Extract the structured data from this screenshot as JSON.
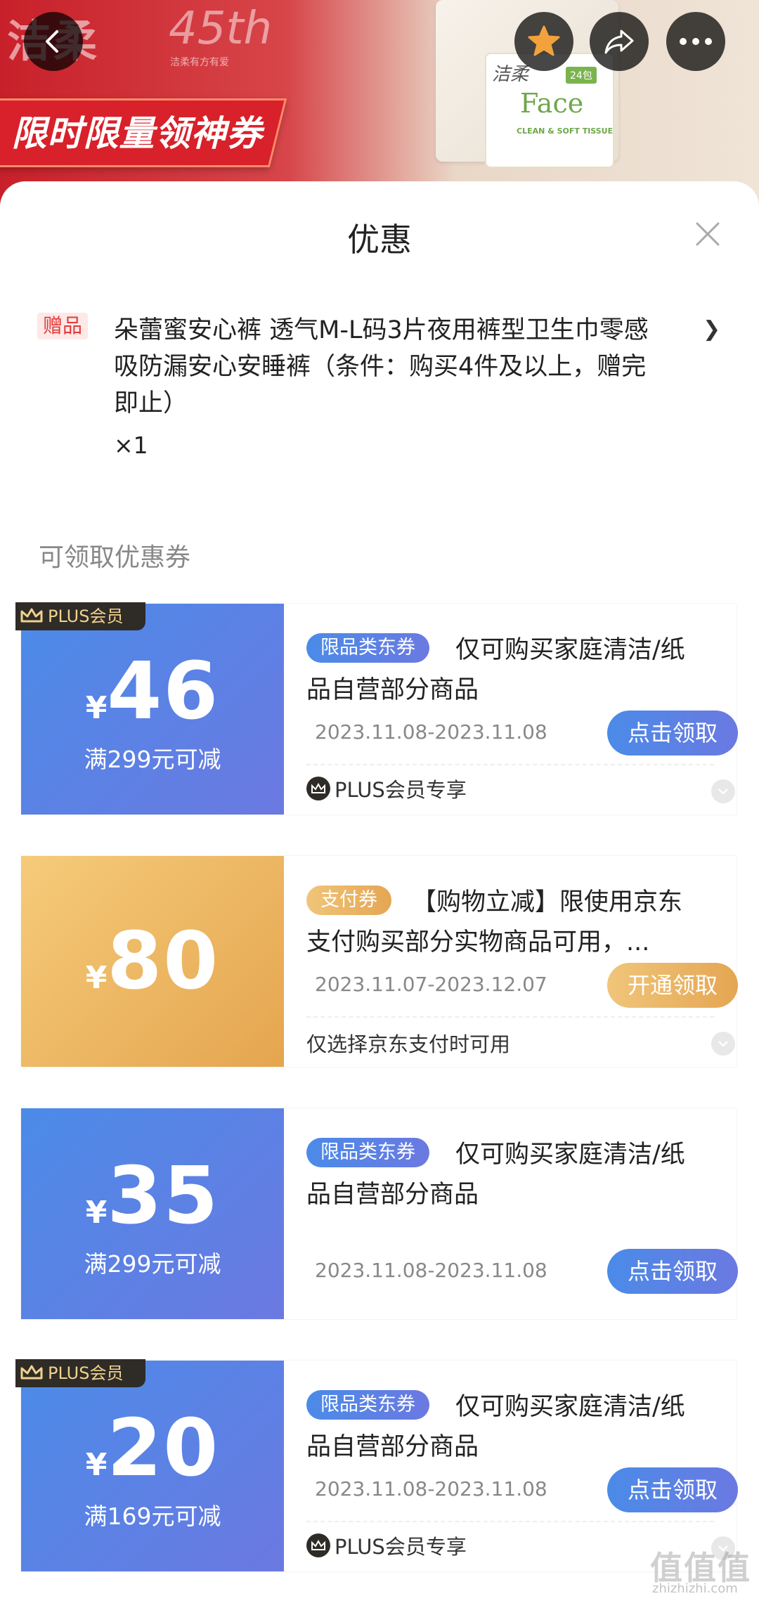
{
  "banner": {
    "brand": "洁柔",
    "anniversary": "45th",
    "anniversary_sub": "洁柔有方有爱",
    "promo": "限时限量领神券",
    "product_brand": "洁柔",
    "product_name": "Face",
    "product_label": "CLEAN & SOFT TISSUE",
    "product_badge": "24包"
  },
  "sheet": {
    "title": "优惠"
  },
  "gift": {
    "tag": "赠品",
    "description": "朵蕾蜜安心裤 透气M-L码3片夜用裤型卫生巾零感吸防漏安心安睡裤（条件：购买4件及以上，赠完即止）",
    "quantity": "×1"
  },
  "coupons_section": {
    "title": "可领取优惠券"
  },
  "coupons": [
    {
      "plus_badge": "PLUS会员",
      "currency": "¥",
      "amount": "46",
      "threshold": "满299元可减",
      "type": "限品类东券",
      "description": "仅可购买家庭清洁/纸品自营部分商品",
      "date": "2023.11.08-2023.11.08",
      "button": "点击领取",
      "footer": "PLUS会员专享"
    },
    {
      "currency": "¥",
      "amount": "80",
      "type": "支付券",
      "description": "【购物立减】限使用京东支付购买部分实物商品可用，...",
      "date": "2023.11.07-2023.12.07",
      "button": "开通领取",
      "footer": "仅选择京东支付时可用"
    },
    {
      "currency": "¥",
      "amount": "35",
      "threshold": "满299元可减",
      "type": "限品类东券",
      "description": "仅可购买家庭清洁/纸品自营部分商品",
      "date": "2023.11.08-2023.11.08",
      "button": "点击领取"
    },
    {
      "plus_badge": "PLUS会员",
      "currency": "¥",
      "amount": "20",
      "threshold": "满169元可减",
      "type": "限品类东券",
      "description": "仅可购买家庭清洁/纸品自营部分商品",
      "date": "2023.11.08-2023.11.08",
      "button": "点击领取",
      "footer": "PLUS会员专享"
    }
  ],
  "watermark": {
    "text": "值值值",
    "sub": "zhizhizhi.com"
  },
  "icons": [
    "back-icon",
    "star-icon",
    "share-icon",
    "more-icon",
    "close-icon",
    "chevron-right-icon",
    "crown-icon",
    "chevron-down-icon"
  ],
  "colors": {
    "accent_blue": "#4b8be8",
    "accent_gold": "#e5a54f",
    "gift_red": "#e33b3b"
  }
}
